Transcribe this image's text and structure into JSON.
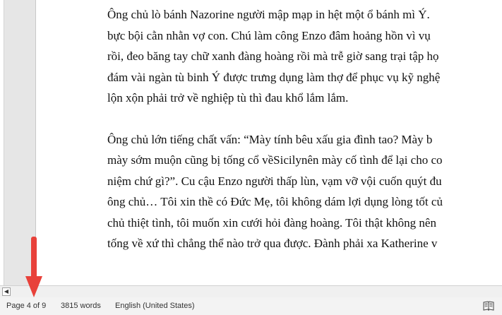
{
  "document": {
    "paragraphs": [
      [
        "Ông chủ lò bánh Nazorine người mập mạp in hệt một ổ bánh mì Ý.",
        "bực bội cằn nhằn vợ con. Chú làm công Enzo đâm hoảng hồn vì vụ",
        "rồi, đeo băng tay chữ xanh đàng hoàng rồi mà trễ giờ sang trại tập họ",
        "đám vài ngàn tù binh Ý được trưng dụng làm thợ để phục vụ kỹ nghệ",
        "lộn xộn phải trở về nghiệp tù thì đau khổ lắm lắm."
      ],
      [
        "Ông chủ lớn tiếng chất vấn: “Mày tính bêu xấu gia đình tao? Mày b",
        "mày sớm muộn cũng bị tống cổ vềSicilynên mày cố tình để lại cho co",
        "niệm chứ gì?”. Cu cậu Enzo người thấp lùn, vạm vỡ vội cuốn quýt đu",
        "ông chủ… Tôi xin thề có Đức Mẹ, tôi không dám lợi dụng lòng tốt củ",
        "chủ thiệt tình, tôi muốn xin cưới hỏi đàng hoàng. Tôi thật không nên",
        "tống về xứ thì chẳng thể nào trở qua được. Đành phải xa Katherine v"
      ]
    ]
  },
  "status": {
    "page": "Page 4 of 9",
    "words": "3815 words",
    "language": "English (United States)"
  },
  "icons": {
    "scroll_left": "scroll-left-arrow-icon",
    "read_mode": "read-mode-icon",
    "annotation": "red-down-arrow-icon"
  },
  "colors": {
    "annotation_arrow": "#e8413a",
    "status_bar": "#f3f3f3"
  }
}
